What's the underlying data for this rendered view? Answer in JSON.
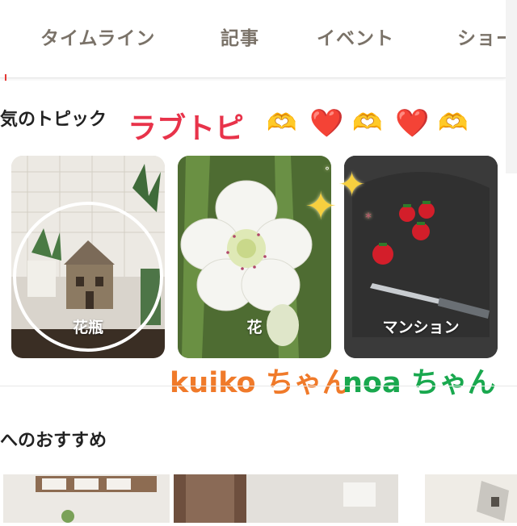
{
  "tabs": [
    {
      "label": "タイムライン"
    },
    {
      "label": "記事"
    },
    {
      "label": "イベント"
    },
    {
      "label": "ショー"
    }
  ],
  "topics_section": {
    "title": "気のトピック",
    "overlay_title": "ラブトピ",
    "emojis": [
      "🫶",
      "❤️",
      "🫶",
      "❤️",
      "🫶"
    ]
  },
  "topic_cards": [
    {
      "label": "花瓶"
    },
    {
      "label": "花"
    },
    {
      "label": "マンション"
    }
  ],
  "names": [
    {
      "text": "kuiko ちゃん",
      "color": "#f07a2a"
    },
    {
      "text": "noa ちゃん",
      "color": "#19a84e"
    }
  ],
  "recommend_section": {
    "title": "へのおすすめ"
  },
  "colors": {
    "tab_text": "#7a7268",
    "overlay_pink": "#e8334a",
    "kuiko_orange": "#f07a2a",
    "noa_green": "#19a84e"
  }
}
